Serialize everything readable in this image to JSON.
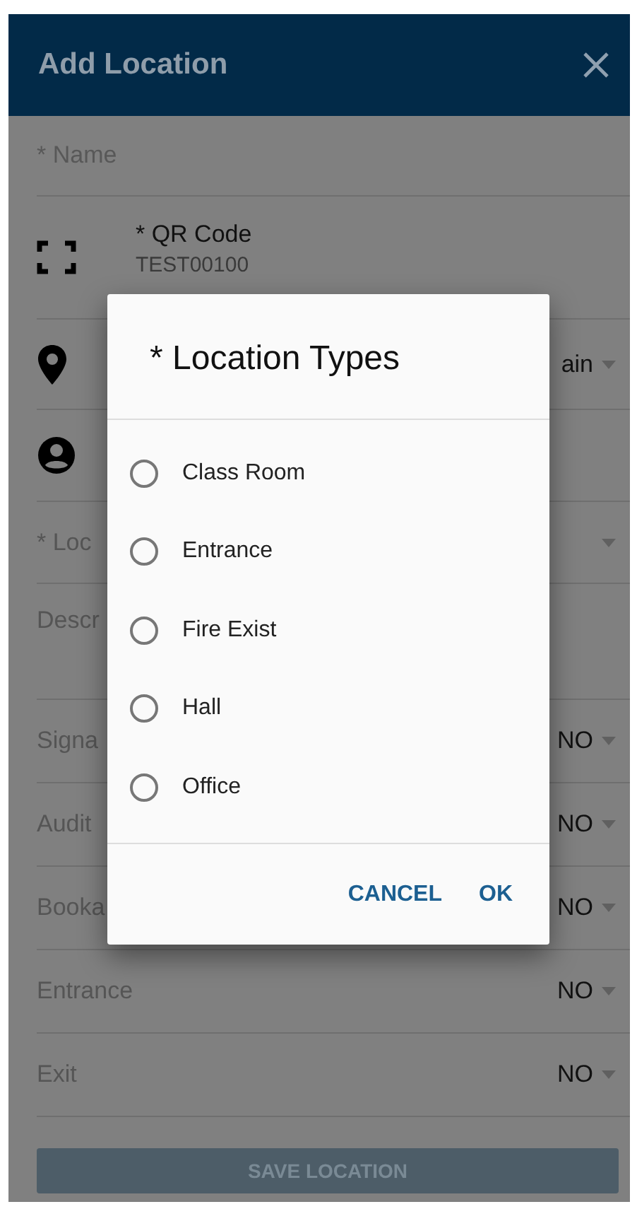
{
  "header": {
    "title": "Add Location"
  },
  "form": {
    "name_placeholder": "* Name",
    "qr_label": "* QR Code",
    "qr_value": "TEST00100",
    "location_value": "ain",
    "type_label": "* Loc",
    "description_label": "Descr",
    "toggles": [
      {
        "label": "Signa",
        "value": "NO"
      },
      {
        "label": "Audit",
        "value": "NO"
      },
      {
        "label": "Booka",
        "value": "NO"
      },
      {
        "label": "Entrance",
        "value": "NO"
      },
      {
        "label": "Exit",
        "value": "NO"
      }
    ],
    "save_button": "SAVE LOCATION",
    "save_disabled": true
  },
  "dialog": {
    "title": "* Location Types",
    "options": [
      {
        "label": "Class Room",
        "selected": false
      },
      {
        "label": "Entrance",
        "selected": false
      },
      {
        "label": "Fire Exist",
        "selected": false
      },
      {
        "label": "Hall",
        "selected": false
      },
      {
        "label": "Office",
        "selected": false
      }
    ],
    "buttons": [
      "CANCEL",
      "OK"
    ]
  }
}
